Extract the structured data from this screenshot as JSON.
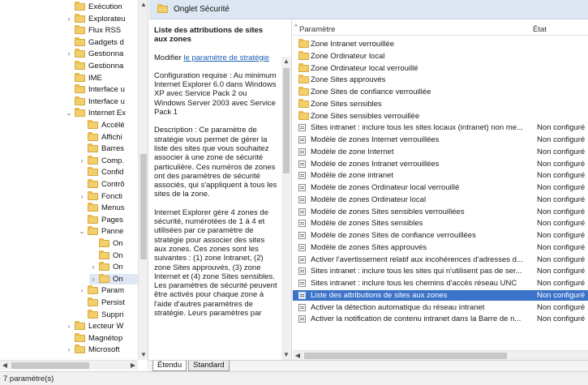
{
  "tree": {
    "items": [
      {
        "label": "Exécution",
        "indent": 0,
        "twisty": "",
        "sel": false
      },
      {
        "label": "Explorateu",
        "indent": 0,
        "twisty": ">",
        "sel": false
      },
      {
        "label": "Flux RSS",
        "indent": 0,
        "twisty": "",
        "sel": false
      },
      {
        "label": "Gadgets d",
        "indent": 0,
        "twisty": "",
        "sel": false
      },
      {
        "label": "Gestionna",
        "indent": 0,
        "twisty": ">",
        "sel": false
      },
      {
        "label": "Gestionna",
        "indent": 0,
        "twisty": "",
        "sel": false
      },
      {
        "label": "IME",
        "indent": 0,
        "twisty": "",
        "sel": false
      },
      {
        "label": "Interface u",
        "indent": 0,
        "twisty": "",
        "sel": false
      },
      {
        "label": "Interface u",
        "indent": 0,
        "twisty": "",
        "sel": false
      },
      {
        "label": "Internet Ex",
        "indent": 0,
        "twisty": "v",
        "sel": false
      },
      {
        "label": "Accélé",
        "indent": 1,
        "twisty": "",
        "sel": false
      },
      {
        "label": "Affichi",
        "indent": 1,
        "twisty": "",
        "sel": false
      },
      {
        "label": "Barres",
        "indent": 1,
        "twisty": "",
        "sel": false
      },
      {
        "label": "Comp.",
        "indent": 1,
        "twisty": ">",
        "sel": false
      },
      {
        "label": "Confid",
        "indent": 1,
        "twisty": "",
        "sel": false
      },
      {
        "label": "Contrô",
        "indent": 1,
        "twisty": "",
        "sel": false
      },
      {
        "label": "Foncti",
        "indent": 1,
        "twisty": ">",
        "sel": false
      },
      {
        "label": "Menus",
        "indent": 1,
        "twisty": "",
        "sel": false
      },
      {
        "label": "Pages",
        "indent": 1,
        "twisty": "",
        "sel": false
      },
      {
        "label": "Panne",
        "indent": 1,
        "twisty": "v",
        "sel": false
      },
      {
        "label": "On",
        "indent": 2,
        "twisty": "",
        "sel": false
      },
      {
        "label": "On",
        "indent": 2,
        "twisty": "",
        "sel": false
      },
      {
        "label": "On",
        "indent": 2,
        "twisty": ">",
        "sel": false
      },
      {
        "label": "On",
        "indent": 2,
        "twisty": ">",
        "sel": true
      },
      {
        "label": "Param",
        "indent": 1,
        "twisty": ">",
        "sel": false
      },
      {
        "label": "Persist",
        "indent": 1,
        "twisty": "",
        "sel": false
      },
      {
        "label": "Suppri",
        "indent": 1,
        "twisty": "",
        "sel": false
      },
      {
        "label": "Lecteur W",
        "indent": 0,
        "twisty": ">",
        "sel": false
      },
      {
        "label": "Magnétop",
        "indent": 0,
        "twisty": "",
        "sel": false
      },
      {
        "label": "Microsoft",
        "indent": 0,
        "twisty": ">",
        "sel": false
      }
    ]
  },
  "header": {
    "title": "Onglet Sécurité"
  },
  "description": {
    "title": "Liste des attributions de sites aux zones",
    "modify_prefix": "Modifier ",
    "modify_link": "le paramètre de stratégie",
    "requirements": "Configuration requise : Au minimum Internet Explorer 6.0 dans Windows XP avec Service Pack 2 ou Windows Server 2003 avec Service Pack 1",
    "desc_para": "Description : Ce paramètre de stratégie vous permet de gérer la liste des sites que vous souhaitez associer à une zone de sécurité particulière. Ces numéros de zones ont des paramètres de sécurité associés, qui s'appliquent à tous les sites de la zone.",
    "ie_para": "Internet Explorer gère 4 zones de sécurité, numérotées de 1 à 4 et utilisées par ce paramètre de stratégie pour associer des sites aux zones. Ces zones sont les suivantes : (1) zone Intranet, (2) zone Sites approuvés, (3) zone Internet et (4) zone Sites sensibles. Les paramètres de sécurité peuvent être activés pour chaque zone à l'aide d'autres paramètres de stratégie. Leurs paramètres par"
  },
  "list": {
    "col_param": "Paramètre",
    "col_state": "État",
    "rows": [
      {
        "kind": "folder",
        "name": "Zone Intranet verrouillée",
        "state": ""
      },
      {
        "kind": "folder",
        "name": "Zone Ordinateur local",
        "state": ""
      },
      {
        "kind": "folder",
        "name": "Zone Ordinateur local verrouillé",
        "state": ""
      },
      {
        "kind": "folder",
        "name": "Zone Sites approuvés",
        "state": ""
      },
      {
        "kind": "folder",
        "name": "Zone Sites de confiance verrouillée",
        "state": ""
      },
      {
        "kind": "folder",
        "name": "Zone Sites sensibles",
        "state": ""
      },
      {
        "kind": "folder",
        "name": "Zone Sites sensibles verrouillée",
        "state": ""
      },
      {
        "kind": "policy",
        "name": "Sites intranet : inclure tous les sites locaux (intranet) non me...",
        "state": "Non configuré"
      },
      {
        "kind": "policy",
        "name": "Modèle de zones Internet verrouillées",
        "state": "Non configuré"
      },
      {
        "kind": "policy",
        "name": "Modèle de zone Internet",
        "state": "Non configuré"
      },
      {
        "kind": "policy",
        "name": "Modèle de zones Intranet verrouillées",
        "state": "Non configuré"
      },
      {
        "kind": "policy",
        "name": "Modèle de zone intranet",
        "state": "Non configuré"
      },
      {
        "kind": "policy",
        "name": "Modèle de zones Ordinateur local verrouillé",
        "state": "Non configuré"
      },
      {
        "kind": "policy",
        "name": "Modèle de zones Ordinateur local",
        "state": "Non configuré"
      },
      {
        "kind": "policy",
        "name": "Modèle de zones Sites sensibles verrouillées",
        "state": "Non configuré"
      },
      {
        "kind": "policy",
        "name": "Modèle de zones Sites sensibles",
        "state": "Non configuré"
      },
      {
        "kind": "policy",
        "name": "Modèle de zones Sites de confiance verrouillées",
        "state": "Non configuré"
      },
      {
        "kind": "policy",
        "name": "Modèle de zones Sites approuvés",
        "state": "Non configuré"
      },
      {
        "kind": "policy",
        "name": "Activer l'avertissement relatif aux incohérences d'adresses d...",
        "state": "Non configuré"
      },
      {
        "kind": "policy",
        "name": "Sites intranet : inclure tous les sites qui n'utilisent pas de ser...",
        "state": "Non configuré"
      },
      {
        "kind": "policy",
        "name": "Sites intranet : inclure tous les chemins d'accès réseau UNC",
        "state": "Non configuré"
      },
      {
        "kind": "policy",
        "name": "Liste des attributions de sites aux zones",
        "state": "Non configuré",
        "selected": true
      },
      {
        "kind": "policy",
        "name": "Activer la détection automatique du réseau intranet",
        "state": "Non configuré"
      },
      {
        "kind": "policy",
        "name": "Activer la notification de contenu intranet dans la Barre de n...",
        "state": "Non configuré"
      }
    ]
  },
  "tabs": {
    "extended": "Étendu",
    "standard": "Standard"
  },
  "status": {
    "text": "7 paramètre(s)"
  },
  "colors": {
    "selection": "#3b73c9",
    "header_bg": "#dde7f3",
    "link": "#1a5fb4",
    "folder": "#f3cf6b"
  }
}
